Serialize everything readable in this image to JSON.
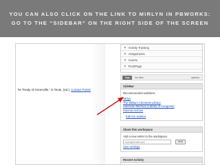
{
  "slide": {
    "title_line1": "YOU CAN ALSO CLICK ON THE LINK TO MIRLYN IN PBWORKS:",
    "title_line2": "GO TO THE “SIDEBAR” ON THE RIGHT SIDE OF THE SCREEN"
  },
  "page": {
    "main_text": "he Treaty of Greenville,” in Teute, (ed.),",
    "main_link": "Contact Points"
  },
  "nav": {
    "items": [
      {
        "label": "Activity Tracking"
      },
      {
        "label": "Assignments"
      },
      {
        "label": "Course"
      },
      {
        "label": "FrontPage"
      }
    ]
  },
  "tag_row": {
    "tag_label": "Tags",
    "no_files": "No files",
    "options": "options"
  },
  "sidebar": {
    "title": "SideBar",
    "recommended": "Recommended websites:",
    "links": [
      {
        "label": "Mirlyn"
      },
      {
        "label": "The William Clements Library"
      },
      {
        "label": "American Memory (Library of Congress)"
      },
      {
        "label": "Internet Archive"
      }
    ],
    "edit_link": "Edit the sidebar"
  },
  "share": {
    "title": "Share this workspace",
    "prompt": "Add a new writer to the workspace.",
    "email_placeholder": "user@email.com",
    "add_button": "Add",
    "settings_link": "User settings"
  },
  "recent": {
    "title": "Recent Activity"
  },
  "colors": {
    "title_band": "#7a7a7a",
    "link": "#1a4fb8",
    "arrow": "#d01818"
  }
}
